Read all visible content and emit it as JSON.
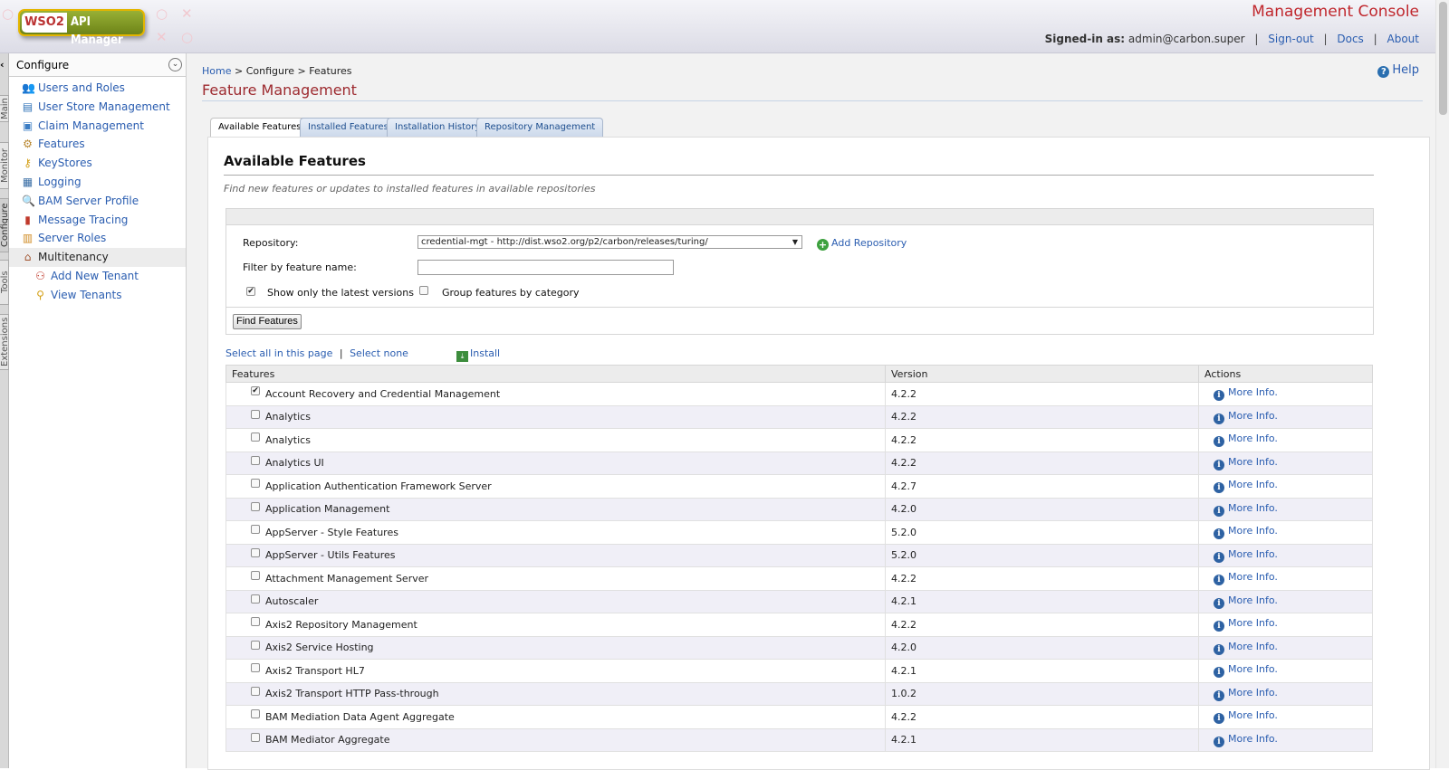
{
  "header": {
    "logo_brand": "WSO2",
    "logo_product": "API Manager",
    "console_title": "Management Console",
    "signed_in_label": "Signed-in as:",
    "user": "admin@carbon.super",
    "links": [
      "Sign-out",
      "Docs",
      "About"
    ]
  },
  "side_tabs": [
    "Main",
    "Monitor",
    "Configure",
    "Tools",
    "Extensions"
  ],
  "sidebar": {
    "title": "Configure",
    "items": [
      {
        "label": "Users and Roles",
        "icon": "users-icon"
      },
      {
        "label": "User Store Management",
        "icon": "user-store-icon"
      },
      {
        "label": "Claim Management",
        "icon": "claim-icon"
      },
      {
        "label": "Features",
        "icon": "features-icon"
      },
      {
        "label": "KeyStores",
        "icon": "key-icon"
      },
      {
        "label": "Logging",
        "icon": "logging-icon"
      },
      {
        "label": "BAM Server Profile",
        "icon": "bam-profile-icon"
      },
      {
        "label": "Message Tracing",
        "icon": "chart-icon"
      },
      {
        "label": "Server Roles",
        "icon": "server-roles-icon"
      },
      {
        "label": "Multitenancy",
        "icon": "multitenancy-icon"
      },
      {
        "label": "Add New Tenant",
        "icon": "add-tenant-icon"
      },
      {
        "label": "View Tenants",
        "icon": "view-tenants-icon"
      }
    ]
  },
  "breadcrumb": {
    "home": "Home",
    "rest": " > Configure > Features"
  },
  "help_label": "Help",
  "page_title": "Feature Management",
  "tabs": [
    "Available Features",
    "Installed Features",
    "Installation History",
    "Repository Management"
  ],
  "section": {
    "title": "Available Features",
    "description": "Find new features or updates to installed features in available repositories"
  },
  "filter": {
    "repository_label": "Repository:",
    "repository_value": "credential-mgt - http://dist.wso2.org/p2/carbon/releases/turing/",
    "add_repository": "Add Repository",
    "filter_label": "Filter by feature name:",
    "filter_value": "",
    "latest_label": "Show only the latest versions",
    "latest_checked": true,
    "group_label": "Group features by category",
    "group_checked": false,
    "find_button": "Find Features"
  },
  "select_all": "Select all in this page",
  "select_none": "Select none",
  "install": "Install",
  "table": {
    "headers": [
      "Features",
      "Version",
      "Actions"
    ],
    "action_label": "More Info.",
    "rows": [
      {
        "name": "Account Recovery and Credential Management",
        "version": "4.2.2",
        "checked": true
      },
      {
        "name": "Analytics",
        "version": "4.2.2",
        "checked": false
      },
      {
        "name": "Analytics",
        "version": "4.2.2",
        "checked": false
      },
      {
        "name": "Analytics UI",
        "version": "4.2.2",
        "checked": false
      },
      {
        "name": "Application Authentication Framework Server",
        "version": "4.2.7",
        "checked": false
      },
      {
        "name": "Application Management",
        "version": "4.2.0",
        "checked": false
      },
      {
        "name": "AppServer - Style Features",
        "version": "5.2.0",
        "checked": false
      },
      {
        "name": "AppServer - Utils Features",
        "version": "5.2.0",
        "checked": false
      },
      {
        "name": "Attachment Management Server",
        "version": "4.2.2",
        "checked": false
      },
      {
        "name": "Autoscaler",
        "version": "4.2.1",
        "checked": false
      },
      {
        "name": "Axis2 Repository Management",
        "version": "4.2.2",
        "checked": false
      },
      {
        "name": "Axis2 Service Hosting",
        "version": "4.2.0",
        "checked": false
      },
      {
        "name": "Axis2 Transport HL7",
        "version": "4.2.1",
        "checked": false
      },
      {
        "name": "Axis2 Transport HTTP Pass-through",
        "version": "1.0.2",
        "checked": false
      },
      {
        "name": "BAM Mediation Data Agent Aggregate",
        "version": "4.2.2",
        "checked": false
      },
      {
        "name": "BAM Mediator Aggregate",
        "version": "4.2.1",
        "checked": false
      }
    ]
  }
}
